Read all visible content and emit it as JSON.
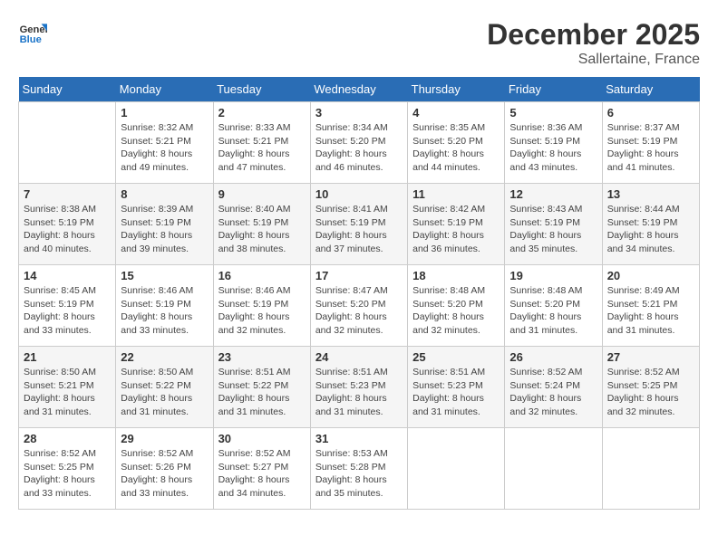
{
  "header": {
    "logo_line1": "General",
    "logo_line2": "Blue",
    "month": "December 2025",
    "location": "Sallertaine, France"
  },
  "weekdays": [
    "Sunday",
    "Monday",
    "Tuesday",
    "Wednesday",
    "Thursday",
    "Friday",
    "Saturday"
  ],
  "weeks": [
    [
      {
        "day": "",
        "info": ""
      },
      {
        "day": "1",
        "info": "Sunrise: 8:32 AM\nSunset: 5:21 PM\nDaylight: 8 hours\nand 49 minutes."
      },
      {
        "day": "2",
        "info": "Sunrise: 8:33 AM\nSunset: 5:21 PM\nDaylight: 8 hours\nand 47 minutes."
      },
      {
        "day": "3",
        "info": "Sunrise: 8:34 AM\nSunset: 5:20 PM\nDaylight: 8 hours\nand 46 minutes."
      },
      {
        "day": "4",
        "info": "Sunrise: 8:35 AM\nSunset: 5:20 PM\nDaylight: 8 hours\nand 44 minutes."
      },
      {
        "day": "5",
        "info": "Sunrise: 8:36 AM\nSunset: 5:19 PM\nDaylight: 8 hours\nand 43 minutes."
      },
      {
        "day": "6",
        "info": "Sunrise: 8:37 AM\nSunset: 5:19 PM\nDaylight: 8 hours\nand 41 minutes."
      }
    ],
    [
      {
        "day": "7",
        "info": "Sunrise: 8:38 AM\nSunset: 5:19 PM\nDaylight: 8 hours\nand 40 minutes."
      },
      {
        "day": "8",
        "info": "Sunrise: 8:39 AM\nSunset: 5:19 PM\nDaylight: 8 hours\nand 39 minutes."
      },
      {
        "day": "9",
        "info": "Sunrise: 8:40 AM\nSunset: 5:19 PM\nDaylight: 8 hours\nand 38 minutes."
      },
      {
        "day": "10",
        "info": "Sunrise: 8:41 AM\nSunset: 5:19 PM\nDaylight: 8 hours\nand 37 minutes."
      },
      {
        "day": "11",
        "info": "Sunrise: 8:42 AM\nSunset: 5:19 PM\nDaylight: 8 hours\nand 36 minutes."
      },
      {
        "day": "12",
        "info": "Sunrise: 8:43 AM\nSunset: 5:19 PM\nDaylight: 8 hours\nand 35 minutes."
      },
      {
        "day": "13",
        "info": "Sunrise: 8:44 AM\nSunset: 5:19 PM\nDaylight: 8 hours\nand 34 minutes."
      }
    ],
    [
      {
        "day": "14",
        "info": "Sunrise: 8:45 AM\nSunset: 5:19 PM\nDaylight: 8 hours\nand 33 minutes."
      },
      {
        "day": "15",
        "info": "Sunrise: 8:46 AM\nSunset: 5:19 PM\nDaylight: 8 hours\nand 33 minutes."
      },
      {
        "day": "16",
        "info": "Sunrise: 8:46 AM\nSunset: 5:19 PM\nDaylight: 8 hours\nand 32 minutes."
      },
      {
        "day": "17",
        "info": "Sunrise: 8:47 AM\nSunset: 5:20 PM\nDaylight: 8 hours\nand 32 minutes."
      },
      {
        "day": "18",
        "info": "Sunrise: 8:48 AM\nSunset: 5:20 PM\nDaylight: 8 hours\nand 32 minutes."
      },
      {
        "day": "19",
        "info": "Sunrise: 8:48 AM\nSunset: 5:20 PM\nDaylight: 8 hours\nand 31 minutes."
      },
      {
        "day": "20",
        "info": "Sunrise: 8:49 AM\nSunset: 5:21 PM\nDaylight: 8 hours\nand 31 minutes."
      }
    ],
    [
      {
        "day": "21",
        "info": "Sunrise: 8:50 AM\nSunset: 5:21 PM\nDaylight: 8 hours\nand 31 minutes."
      },
      {
        "day": "22",
        "info": "Sunrise: 8:50 AM\nSunset: 5:22 PM\nDaylight: 8 hours\nand 31 minutes."
      },
      {
        "day": "23",
        "info": "Sunrise: 8:51 AM\nSunset: 5:22 PM\nDaylight: 8 hours\nand 31 minutes."
      },
      {
        "day": "24",
        "info": "Sunrise: 8:51 AM\nSunset: 5:23 PM\nDaylight: 8 hours\nand 31 minutes."
      },
      {
        "day": "25",
        "info": "Sunrise: 8:51 AM\nSunset: 5:23 PM\nDaylight: 8 hours\nand 31 minutes."
      },
      {
        "day": "26",
        "info": "Sunrise: 8:52 AM\nSunset: 5:24 PM\nDaylight: 8 hours\nand 32 minutes."
      },
      {
        "day": "27",
        "info": "Sunrise: 8:52 AM\nSunset: 5:25 PM\nDaylight: 8 hours\nand 32 minutes."
      }
    ],
    [
      {
        "day": "28",
        "info": "Sunrise: 8:52 AM\nSunset: 5:25 PM\nDaylight: 8 hours\nand 33 minutes."
      },
      {
        "day": "29",
        "info": "Sunrise: 8:52 AM\nSunset: 5:26 PM\nDaylight: 8 hours\nand 33 minutes."
      },
      {
        "day": "30",
        "info": "Sunrise: 8:52 AM\nSunset: 5:27 PM\nDaylight: 8 hours\nand 34 minutes."
      },
      {
        "day": "31",
        "info": "Sunrise: 8:53 AM\nSunset: 5:28 PM\nDaylight: 8 hours\nand 35 minutes."
      },
      {
        "day": "",
        "info": ""
      },
      {
        "day": "",
        "info": ""
      },
      {
        "day": "",
        "info": ""
      }
    ]
  ]
}
